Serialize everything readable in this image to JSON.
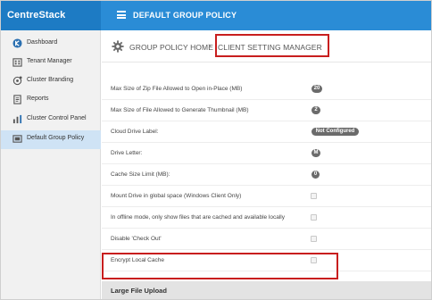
{
  "app": {
    "logo": "CentreStack",
    "title": "DEFAULT GROUP POLICY"
  },
  "sidebar": {
    "items": [
      {
        "label": "Dashboard",
        "icon": "dashboard-icon",
        "active": false
      },
      {
        "label": "Tenant Manager",
        "icon": "tenant-icon",
        "active": false
      },
      {
        "label": "Cluster Branding",
        "icon": "branding-icon",
        "active": false
      },
      {
        "label": "Reports",
        "icon": "reports-icon",
        "active": false
      },
      {
        "label": "Cluster Control Panel",
        "icon": "control-panel-icon",
        "active": false
      },
      {
        "label": "Default Group Policy",
        "icon": "policy-icon",
        "active": true
      }
    ]
  },
  "breadcrumb": {
    "home": "GROUP POLICY HOME",
    "separator": "›",
    "current": "CLIENT SETTING MANAGER"
  },
  "settings": [
    {
      "label": "Max Size of Zip File Allowed to Open in-Place (MB)",
      "type": "value",
      "value": "20"
    },
    {
      "label": "Max Size of File Allowed to Generate Thumbnail (MB)",
      "type": "value",
      "value": "2"
    },
    {
      "label": "Cloud Drive Label:",
      "type": "value",
      "value": "Not Configured"
    },
    {
      "label": "Drive Letter:",
      "type": "value",
      "value": "M"
    },
    {
      "label": "Cache Size Limit (MB):",
      "type": "value",
      "value": "0"
    },
    {
      "label": "Mount Drive in global space (Windows Client Only)",
      "type": "checkbox",
      "checked": false
    },
    {
      "label": "In offline mode, only show files that are cached and available locally",
      "type": "checkbox",
      "checked": false
    },
    {
      "label": "Disable 'Check Out'",
      "type": "checkbox",
      "checked": false
    },
    {
      "label": "Encrypt Local Cache",
      "type": "checkbox",
      "checked": false
    }
  ],
  "section": {
    "title": "Large File Upload"
  },
  "colors": {
    "topbar": "#2a8cd6",
    "logo_bg": "#1d7bc4",
    "highlight": "#c81e1e",
    "pill": "#6b6b6b"
  }
}
